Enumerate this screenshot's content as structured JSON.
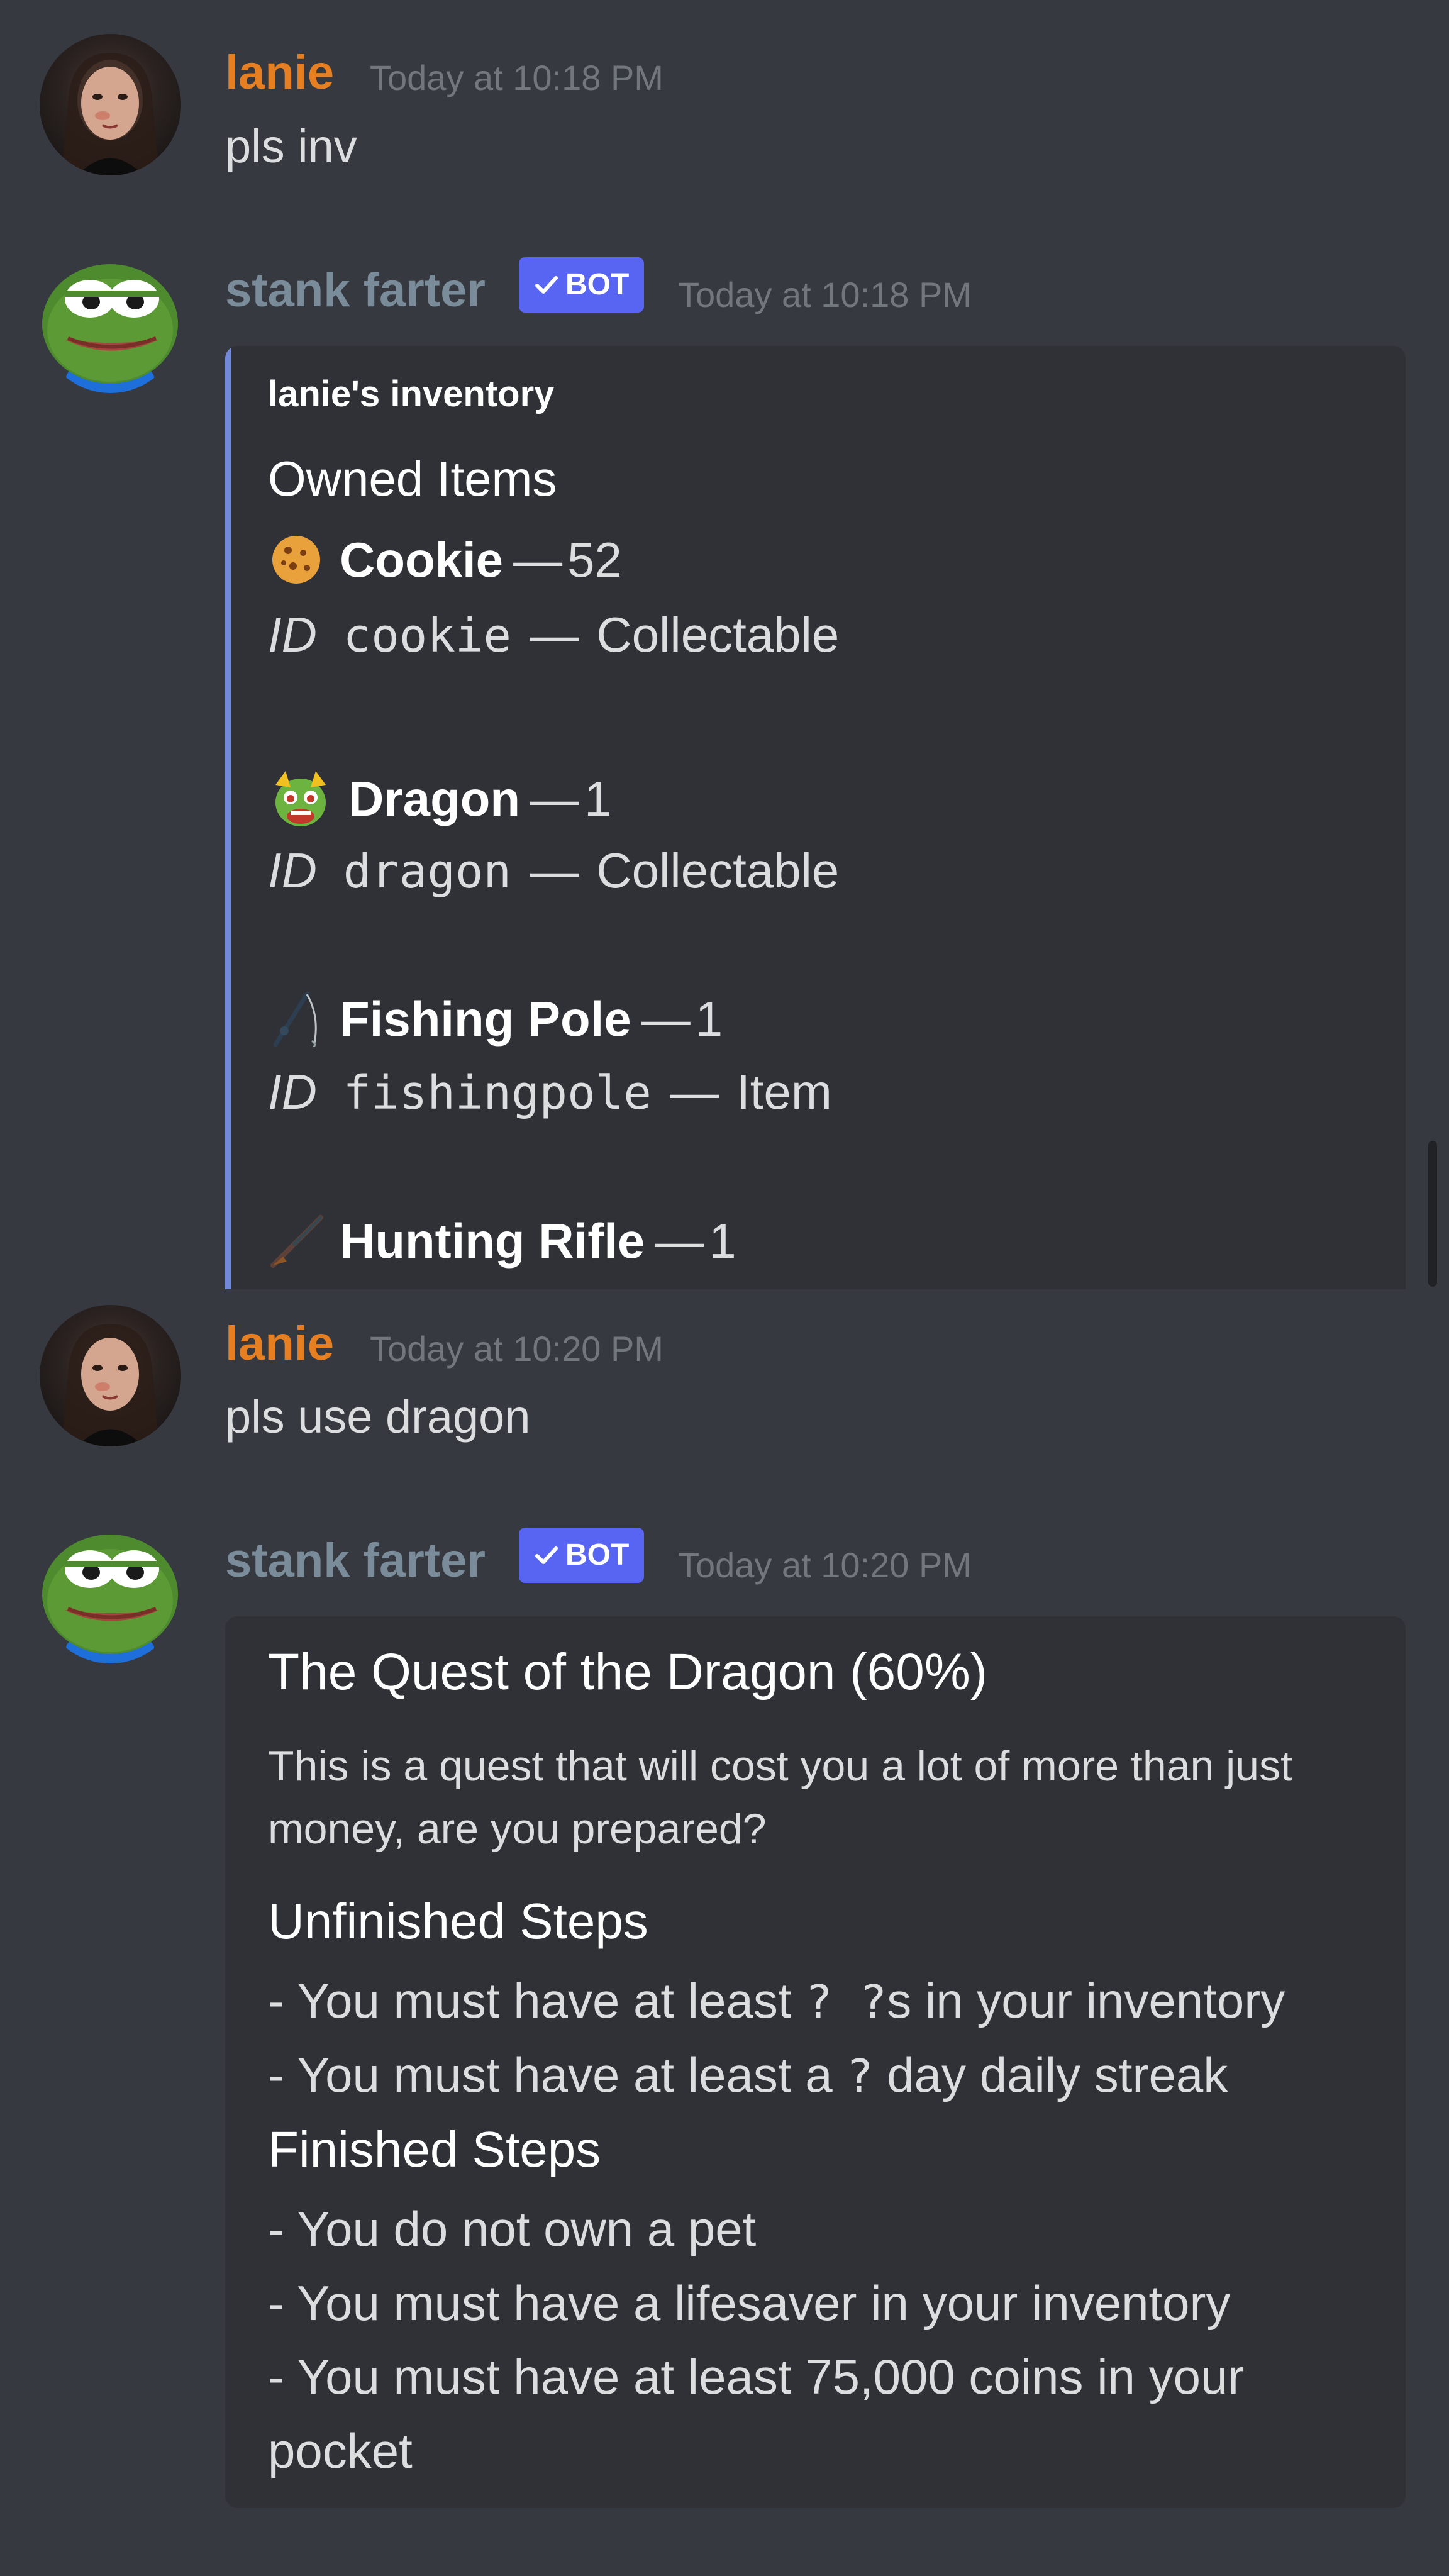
{
  "messages": [
    {
      "author": "lanie",
      "timestamp": "Today at 10:18 PM",
      "text": "pls inv"
    },
    {
      "author": "stank farter",
      "badge": "BOT",
      "timestamp": "Today at 10:18 PM",
      "embed": {
        "author": "lanie's inventory",
        "field_title": "Owned Items",
        "items": [
          {
            "icon": "cookie-icon",
            "name": "Cookie",
            "sep": "—",
            "count": "52",
            "id_prefix": "ID",
            "id": "cookie",
            "type": "Collectable"
          },
          {
            "icon": "dragon-icon",
            "name": "Dragon",
            "sep": "—",
            "count": "1",
            "id_prefix": "ID",
            "id": "dragon",
            "type": "Collectable"
          },
          {
            "icon": "fishing-pole-icon",
            "name": "Fishing Pole",
            "sep": "—",
            "count": "1",
            "id_prefix": "ID",
            "id": "fishingpole",
            "type": "Item"
          },
          {
            "icon": "hunting-rifle-icon",
            "name": "Hunting Rifle",
            "sep": "—",
            "count": "1"
          }
        ]
      }
    },
    {
      "author": "lanie",
      "timestamp": "Today at 10:20 PM",
      "text": "pls use dragon"
    },
    {
      "author": "stank farter",
      "badge": "BOT",
      "timestamp": "Today at 10:20 PM",
      "embed": {
        "title": "The Quest of the Dragon (60%)",
        "description": "This is a quest that will cost you a lot of more than just money, are you prepared?",
        "unfinished_title": "Unfinished Steps",
        "unfinished": [
          {
            "pre": "- You must have at least ",
            "code": "? ?",
            "post": "s in your inventory"
          },
          {
            "pre": "- You must have at least a ",
            "code": "?",
            "post": " day daily streak"
          }
        ],
        "finished_title": "Finished Steps",
        "finished": [
          "- You do not own a pet",
          "- You must have a lifesaver in your inventory",
          "- You must have at least 75,000 coins in your",
          "pocket"
        ]
      }
    }
  ],
  "colors": {
    "background": "#36393f",
    "embed": "#2f3136",
    "embed_accent": "#7289da",
    "human_name": "#e67e22",
    "bot_name": "#7a8c99",
    "badge": "#5865f2"
  }
}
